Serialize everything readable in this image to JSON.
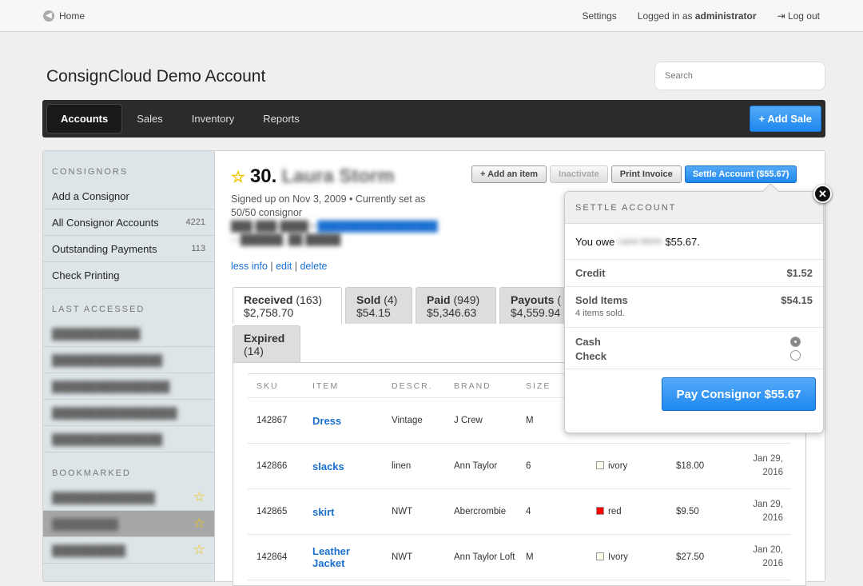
{
  "topbar": {
    "home": "Home",
    "settings": "Settings",
    "logged_prefix": "Logged in as",
    "user": "administrator",
    "logout": "Log out"
  },
  "header": {
    "title": "ConsignCloud Demo Account",
    "search_placeholder": "Search"
  },
  "nav": {
    "tabs": [
      "Accounts",
      "Sales",
      "Inventory",
      "Reports"
    ],
    "add_sale": "+ Add Sale"
  },
  "sidebar": {
    "consignors_heading": "CONSIGNORS",
    "items": [
      {
        "label": "Add a Consignor",
        "count": ""
      },
      {
        "label": "All Consignor Accounts",
        "count": "4221"
      },
      {
        "label": "Outstanding Payments",
        "count": "113"
      },
      {
        "label": "Check Printing",
        "count": ""
      }
    ],
    "last_heading": "LAST ACCESSED",
    "bookmarked_heading": "BOOKMARKED"
  },
  "consignor": {
    "number": "30.",
    "name": "Laura Storm",
    "signup": "Signed up on Nov 3, 2009 • Currently set as 50/50 consignor",
    "less_info": "less info",
    "edit": "edit",
    "delete": "delete"
  },
  "actions": {
    "add_item": "+ Add an item",
    "inactivate": "Inactivate",
    "print_invoice": "Print Invoice",
    "settle": "Settle Account ($55.67)"
  },
  "tabs": [
    {
      "label": "Received",
      "count": "(163)",
      "amount": "$2,758.70"
    },
    {
      "label": "Sold",
      "count": "(4)",
      "amount": "$54.15"
    },
    {
      "label": "Paid",
      "count": "(949)",
      "amount": "$5,346.63"
    },
    {
      "label": "Payouts",
      "count": "(",
      "amount": "$4,559.94"
    },
    {
      "label": "Expired",
      "count": "(14)",
      "amount": ""
    }
  ],
  "table": {
    "headers": [
      "SKU",
      "ITEM",
      "DESCR.",
      "BRAND",
      "SIZE"
    ],
    "rows": [
      {
        "sku": "142867",
        "item": "Dress",
        "descr": "Vintage",
        "brand": "J Crew",
        "size": "M",
        "color": "",
        "color_hex": "",
        "price": "",
        "date": ""
      },
      {
        "sku": "142866",
        "item": "slacks",
        "descr": "linen",
        "brand": "Ann Taylor",
        "size": "6",
        "color": "ivory",
        "color_hex": "#fffff0",
        "price": "$18.00",
        "date": "Jan 29, 2016"
      },
      {
        "sku": "142865",
        "item": "skirt",
        "descr": "NWT",
        "brand": "Abercrombie",
        "size": "4",
        "color": "red",
        "color_hex": "#ff0000",
        "price": "$9.50",
        "date": "Jan 29, 2016"
      },
      {
        "sku": "142864",
        "item": "Leather Jacket",
        "descr": "NWT",
        "brand": "Ann Taylor Loft",
        "size": "M",
        "color": "Ivory",
        "color_hex": "#fffff0",
        "price": "$27.50",
        "date": "Jan 20, 2016"
      }
    ]
  },
  "settle": {
    "heading": "SETTLE ACCOUNT",
    "you_owe": "You owe",
    "owe_amount": "$55.67.",
    "credit_label": "Credit",
    "credit": "$1.52",
    "sold_label": "Sold Items",
    "sold": "$54.15",
    "sold_note": "4 items sold.",
    "cash": "Cash",
    "check": "Check",
    "selected": "Cash",
    "pay": "Pay Consignor $55.67"
  }
}
